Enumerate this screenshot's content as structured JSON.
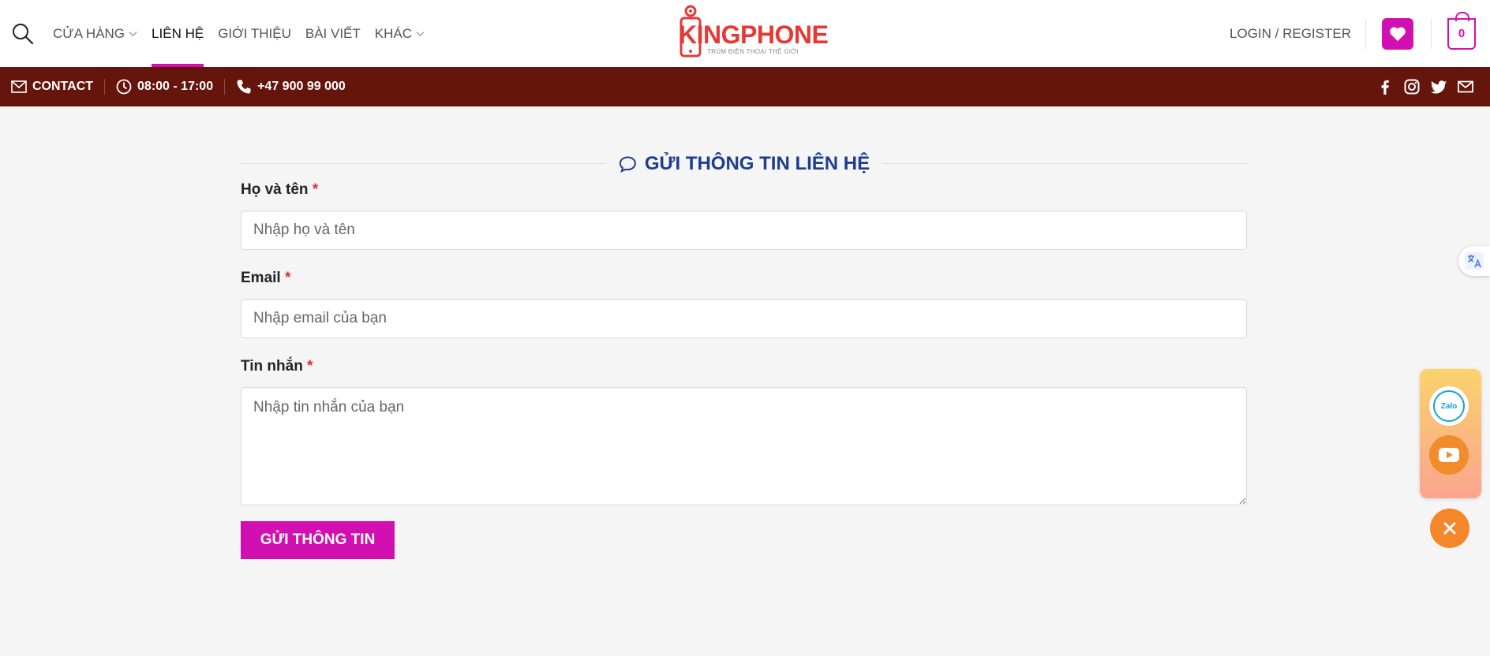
{
  "header": {
    "nav": [
      {
        "label": "CỬA HÀNG",
        "has_dropdown": true,
        "active": false
      },
      {
        "label": "LIÊN HỆ",
        "has_dropdown": false,
        "active": true
      },
      {
        "label": "GIỚI THIỆU",
        "has_dropdown": false,
        "active": false
      },
      {
        "label": "BÀI VIẾT",
        "has_dropdown": false,
        "active": false
      },
      {
        "label": "KHÁC",
        "has_dropdown": true,
        "active": false
      }
    ],
    "logo_text": "KINGPHONE",
    "logo_tagline": "TRÙM ĐIỆN THOẠI THẾ GIỚI",
    "login_label": "LOGIN / REGISTER",
    "cart_count": "0"
  },
  "topbar": {
    "contact_label": "CONTACT",
    "hours": "08:00 - 17:00",
    "phone": "+47 900 99 000",
    "social_icons": [
      "facebook-icon",
      "instagram-icon",
      "twitter-icon",
      "email-icon"
    ]
  },
  "form": {
    "title": "GỬI THÔNG TIN LIÊN HỆ",
    "required_mark": "*",
    "name_label": "Họ và tên",
    "name_placeholder": "Nhập họ và tên",
    "email_label": "Email",
    "email_placeholder": "Nhập email của bạn",
    "message_label": "Tin nhắn",
    "message_placeholder": "Nhập tin nhắn của bạn",
    "submit_label": "GỬI THÔNG TIN"
  },
  "floating": {
    "zalo_label": "Zalo"
  },
  "colors": {
    "accent": "#d20fb1",
    "topbar": "#65150c",
    "title": "#1e3d8f",
    "required": "#e02b27",
    "orange": "#f5862a"
  }
}
